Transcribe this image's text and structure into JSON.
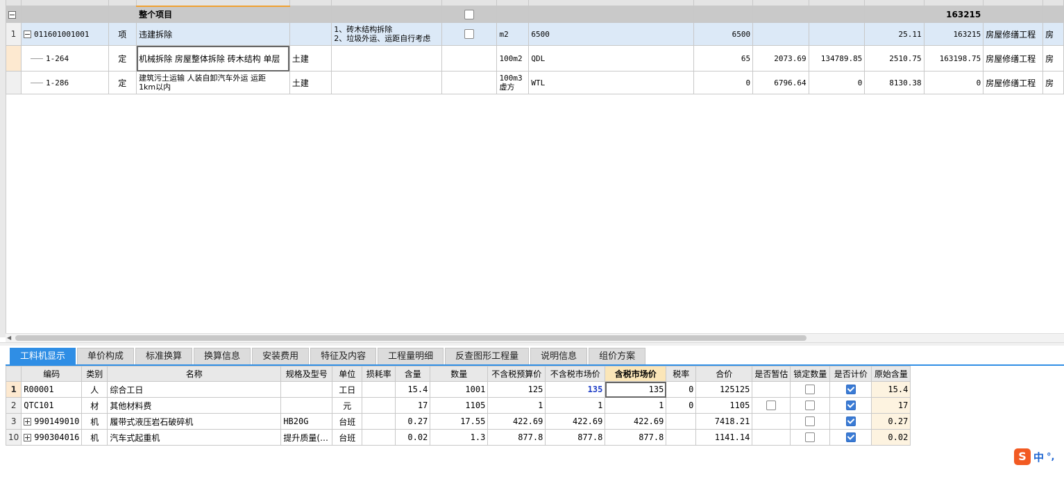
{
  "main_table": {
    "summary_row": {
      "label": "整个项目",
      "total": "163215"
    },
    "rows": [
      {
        "rownum": "1",
        "code": "011601001001",
        "type": "项",
        "name": "违建拆除",
        "major": "",
        "feature_line1": "1、砖木结构拆除",
        "feature_line2": "2、垃圾外运、运距自行考虑",
        "unit": "m2",
        "expr": "6500",
        "qty": "6500",
        "price": "",
        "total": "",
        "comp_price": "25.11",
        "comp_total": "163215",
        "category": "房屋修缮工程",
        "extra": "房"
      },
      {
        "rownum": "",
        "code": "1-264",
        "type": "定",
        "name": "机械拆除 房屋整体拆除 砖木结构 单层",
        "major": "土建",
        "unit": "100m2",
        "expr": "QDL",
        "qty": "65",
        "price": "2073.69",
        "total": "134789.85",
        "comp_price": "2510.75",
        "comp_total": "163198.75",
        "category": "房屋修缮工程",
        "extra": "房"
      },
      {
        "rownum": "",
        "code": "1-286",
        "type": "定",
        "name_line1": "建筑污土运输 人装自卸汽车外运 运距",
        "name_line2": "1km以内",
        "major": "土建",
        "unit_line1": "100m3",
        "unit_line2": "虚方",
        "expr": "WTL",
        "qty": "0",
        "price": "6796.64",
        "total": "0",
        "comp_price": "8130.38",
        "comp_total": "0",
        "category": "房屋修缮工程",
        "extra": "房"
      }
    ]
  },
  "tabs": [
    "工料机显示",
    "单价构成",
    "标准换算",
    "换算信息",
    "安装费用",
    "特征及内容",
    "工程量明细",
    "反查图形工程量",
    "说明信息",
    "组价方案"
  ],
  "detail": {
    "headers": [
      "编码",
      "类别",
      "名称",
      "规格及型号",
      "单位",
      "损耗率",
      "含量",
      "数量",
      "不含税预算价",
      "不含税市场价",
      "含税市场价",
      "税率",
      "合价",
      "是否暂估",
      "锁定数量",
      "是否计价",
      "原始含量"
    ],
    "rows": [
      {
        "no": "1",
        "code": "R00001",
        "cat": "人",
        "name": "综合工日",
        "spec": "",
        "unit": "工日",
        "loss": "",
        "content": "15.4",
        "qty": "1001",
        "budget": "125",
        "market": "135",
        "market_tax": "135",
        "rate": "0",
        "total": "125125",
        "is_est": false,
        "locked": false,
        "priced": true,
        "orig": "15.4"
      },
      {
        "no": "2",
        "code": "QTC101",
        "cat": "材",
        "name": "其他材料费",
        "spec": "",
        "unit": "元",
        "loss": "",
        "content": "17",
        "qty": "1105",
        "budget": "1",
        "market": "1",
        "market_tax": "1",
        "rate": "0",
        "total": "1105",
        "is_est": false,
        "locked": false,
        "priced": true,
        "orig": "17"
      },
      {
        "no": "3",
        "code": "990149010",
        "cat": "机",
        "name": "履带式液压岩石破碎机",
        "spec": "HB20G",
        "unit": "台班",
        "loss": "",
        "content": "0.27",
        "qty": "17.55",
        "budget": "422.69",
        "market": "422.69",
        "market_tax": "422.69",
        "rate": "",
        "total": "7418.21",
        "locked": false,
        "priced": true,
        "orig": "0.27"
      },
      {
        "no": "10",
        "code": "990304016",
        "cat": "机",
        "name": "汽车式起重机",
        "spec": "提升质量(…",
        "unit": "台班",
        "loss": "",
        "content": "0.02",
        "qty": "1.3",
        "budget": "877.8",
        "market": "877.8",
        "market_tax": "877.8",
        "rate": "",
        "total": "1141.14",
        "locked": false,
        "priced": true,
        "orig": "0.02"
      }
    ]
  },
  "ime": {
    "logo": "S",
    "lang": "中",
    "punct": "°,"
  },
  "colors": {
    "tab_active": "#2f8ee5",
    "selected_row": "#dce9f7",
    "summary_row": "#c9c9c9",
    "highlight_header": "#fbe6b8"
  }
}
